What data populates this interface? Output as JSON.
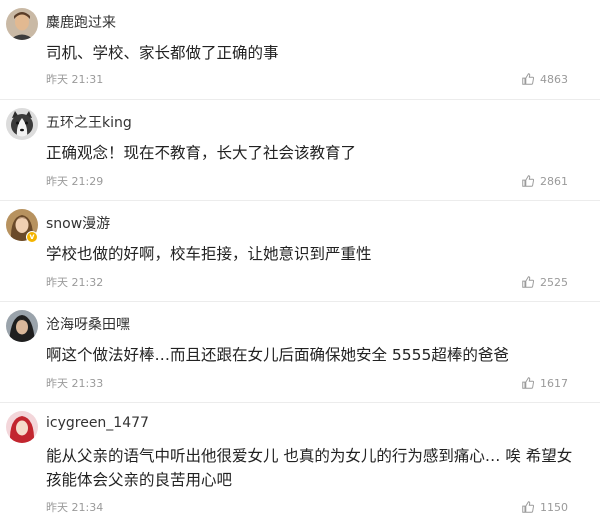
{
  "comments": [
    {
      "username": "麋鹿跑过来",
      "text": "司机、学校、家长都做了正确的事",
      "time": "昨天 21:31",
      "likes": "4863",
      "avatar_icon": "man-portrait-avatar",
      "verified": false
    },
    {
      "username": "五环之王king",
      "text": "正确观念！现在不教育，长大了社会该教育了",
      "time": "昨天 21:29",
      "likes": "2861",
      "avatar_icon": "husky-dog-avatar",
      "verified": false
    },
    {
      "username": "snow漫游",
      "text": "学校也做的好啊，校车拒接，让她意识到严重性",
      "time": "昨天 21:32",
      "likes": "2525",
      "avatar_icon": "woman-portrait-avatar",
      "verified": true
    },
    {
      "username": "沧海呀桑田嘿",
      "text": "啊这个做法好棒…而且还跟在女儿后面确保她安全 5555超棒的爸爸",
      "time": "昨天 21:33",
      "likes": "1617",
      "avatar_icon": "dark-portrait-avatar",
      "verified": false
    },
    {
      "username": "icygreen_1477",
      "text": "能从父亲的语气中听出他很爱女儿 也真的为女儿的行为感到痛心… 唉 希望女孩能体会父亲的良苦用心吧",
      "time": "昨天 21:34",
      "likes": "1150",
      "avatar_icon": "red-hair-avatar",
      "verified": false
    }
  ],
  "colors": {
    "username": "#333333",
    "text": "#222222",
    "meta": "#9a9a9a",
    "divider": "#ececec",
    "verified_badge": "#f4b400"
  }
}
